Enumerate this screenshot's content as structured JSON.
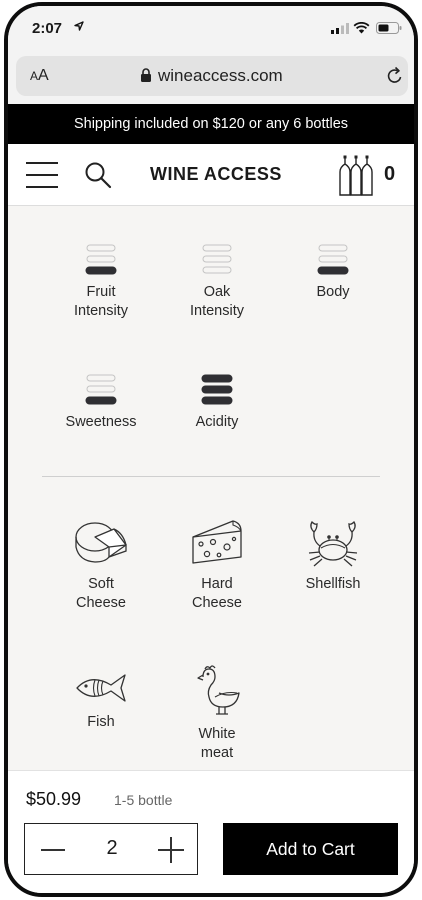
{
  "status_bar": {
    "time": "2:07"
  },
  "browser": {
    "text_size_small": "A",
    "text_size_large": "A",
    "domain": "wineaccess.com"
  },
  "promo": {
    "text": "Shipping included on $120 or any 6 bottles"
  },
  "nav": {
    "brand": "WINE ACCESS",
    "cart_count": "0"
  },
  "characteristics": [
    {
      "label": "Fruit\nIntensity",
      "level": 1,
      "max": 3
    },
    {
      "label": "Oak\nIntensity",
      "level": 0,
      "max": 3
    },
    {
      "label": "Body",
      "level": 1,
      "max": 3
    },
    {
      "label": "Sweetness",
      "level": 1,
      "max": 3
    },
    {
      "label": "Acidity",
      "level": 3,
      "max": 3
    }
  ],
  "pairings": [
    {
      "label": "Soft\nCheese",
      "icon": "soft-cheese-icon"
    },
    {
      "label": "Hard\nCheese",
      "icon": "hard-cheese-icon"
    },
    {
      "label": "Shellfish",
      "icon": "crab-icon"
    },
    {
      "label": "Fish",
      "icon": "fish-icon"
    },
    {
      "label": "White\nmeat",
      "icon": "chicken-icon"
    }
  ],
  "purchase": {
    "price": "$50.99",
    "bottle_range": "1-5 bottle",
    "quantity": "2",
    "add_to_cart_label": "Add to Cart"
  }
}
